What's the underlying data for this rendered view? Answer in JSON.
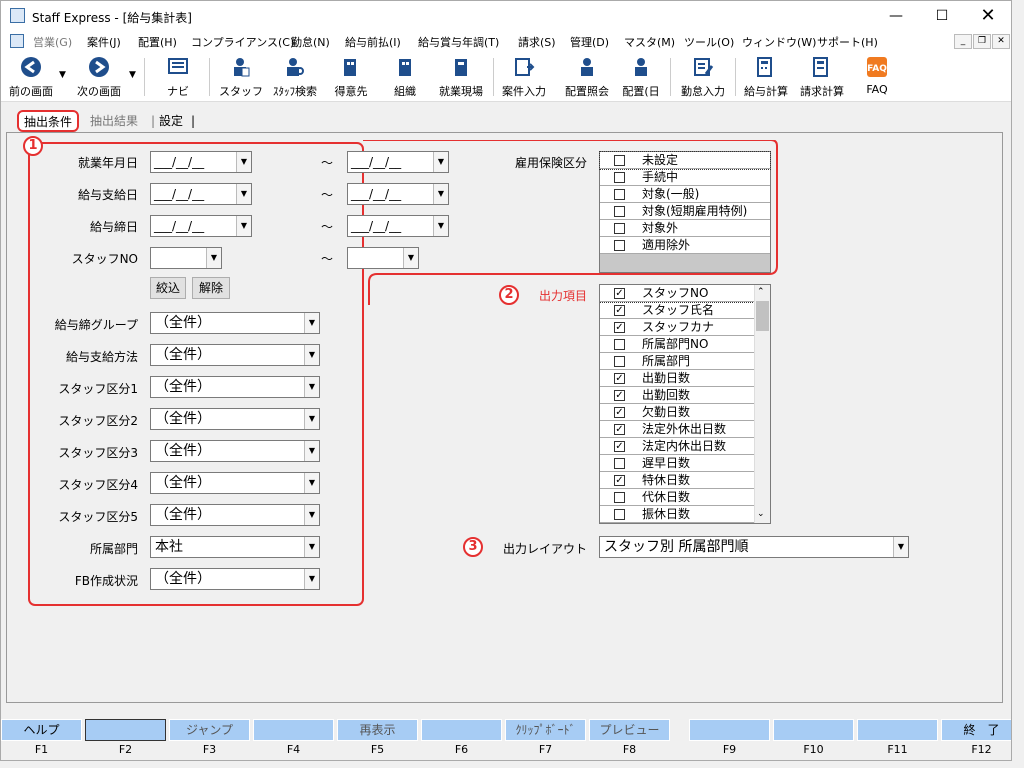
{
  "window": {
    "title": "Staff Express - [給与集計表]"
  },
  "menu": [
    "営業(G)",
    "案件(J)",
    "配置(H)",
    "コンプライアンス(C)",
    "勤怠(N)",
    "給与前払(I)",
    "給与賞与年調(T)",
    "請求(S)",
    "管理(D)",
    "マスタ(M)",
    "ツール(O)",
    "ウィンドウ(W)",
    "サポート(H)"
  ],
  "toolbar": {
    "prev": "前の画面",
    "next": "次の画面",
    "navi": "ナビ",
    "staff": "スタッフ",
    "staff_search": "ｽﾀｯﾌ検索",
    "client": "得意先",
    "org": "組織",
    "site": "就業現場",
    "case_input": "案件入力",
    "assign_inquiry": "配置照会",
    "assign_day": "配置(日",
    "attendance_input": "勤怠入力",
    "salary_calc": "給与計算",
    "billing_calc": "請求計算",
    "faq": "FAQ"
  },
  "tabs": [
    "抽出条件",
    "抽出結果",
    "設定"
  ],
  "markers": [
    "1",
    "2",
    "3"
  ],
  "form": {
    "work_month": "就業年月日",
    "pay_date": "給与支給日",
    "cutoff_date": "給与締日",
    "staff_no": "スタッフNO",
    "date_placeholder": "___/__/__",
    "tilde": "～",
    "btn_filter": "絞込",
    "btn_clear": "解除",
    "pay_group": "給与締グループ",
    "pay_method": "給与支給方法",
    "staff_cat1": "スタッフ区分1",
    "staff_cat2": "スタッフ区分2",
    "staff_cat3": "スタッフ区分3",
    "staff_cat4": "スタッフ区分4",
    "staff_cat5": "スタッフ区分5",
    "dept": "所属部門",
    "fb_status": "FB作成状況",
    "all": "（全件）",
    "dept_value": "本社",
    "insurance_label": "雇用保険区分",
    "output_label": "出力項目",
    "layout_label": "出力レイアウト",
    "layout_value": "スタッフ別 所属部門順"
  },
  "insurance_items": [
    {
      "label": "未設定",
      "checked": false
    },
    {
      "label": "手続中",
      "checked": false
    },
    {
      "label": "対象(一般)",
      "checked": false
    },
    {
      "label": "対象(短期雇用特例)",
      "checked": false
    },
    {
      "label": "対象外",
      "checked": false
    },
    {
      "label": "適用除外",
      "checked": false
    }
  ],
  "output_items": [
    {
      "label": "スタッフNO",
      "checked": true
    },
    {
      "label": "スタッフ氏名",
      "checked": true
    },
    {
      "label": "スタッフカナ",
      "checked": true
    },
    {
      "label": "所属部門NO",
      "checked": false
    },
    {
      "label": "所属部門",
      "checked": false
    },
    {
      "label": "出勤日数",
      "checked": true
    },
    {
      "label": "出勤回数",
      "checked": true
    },
    {
      "label": "欠勤日数",
      "checked": true
    },
    {
      "label": "法定外休出日数",
      "checked": true
    },
    {
      "label": "法定内休出日数",
      "checked": true
    },
    {
      "label": "遅早日数",
      "checked": false
    },
    {
      "label": "特休日数",
      "checked": true
    },
    {
      "label": "代休日数",
      "checked": false
    },
    {
      "label": "振休日数",
      "checked": false
    }
  ],
  "fkeys": [
    {
      "label": "ヘルプ",
      "key": "F1"
    },
    {
      "label": "",
      "key": "F2"
    },
    {
      "label": "ジャンプ",
      "key": "F3"
    },
    {
      "label": "",
      "key": "F4"
    },
    {
      "label": "再表示",
      "key": "F5"
    },
    {
      "label": "",
      "key": "F6"
    },
    {
      "label": "ｸﾘｯﾌﾟﾎﾞｰﾄﾞ",
      "key": "F7"
    },
    {
      "label": "プレビュー",
      "key": "F8"
    },
    {
      "label": "",
      "key": "F9"
    },
    {
      "label": "",
      "key": "F10"
    },
    {
      "label": "",
      "key": "F11"
    },
    {
      "label": "終　了",
      "key": "F12"
    }
  ]
}
